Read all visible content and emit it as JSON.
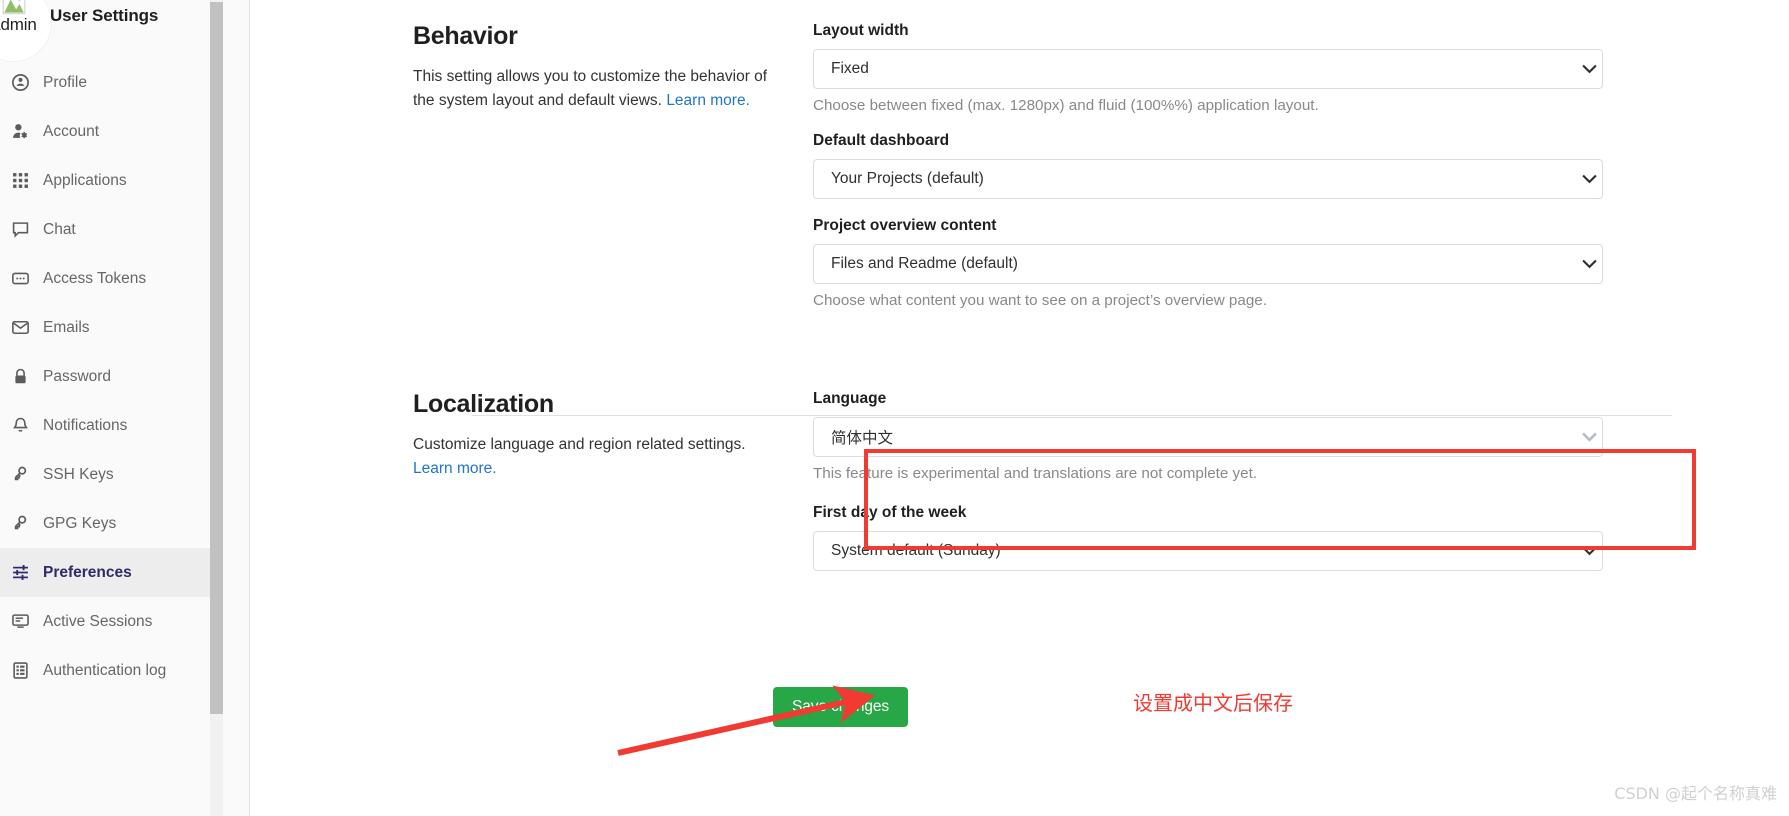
{
  "sidebar": {
    "avatar_name": "Admin",
    "title": "User Settings",
    "items": [
      {
        "label": "Profile",
        "icon": "user-circle-icon",
        "active": false
      },
      {
        "label": "Account",
        "icon": "user-gear-icon",
        "active": false
      },
      {
        "label": "Applications",
        "icon": "grid-apps-icon",
        "active": false
      },
      {
        "label": "Chat",
        "icon": "chat-bubble-icon",
        "active": false
      },
      {
        "label": "Access Tokens",
        "icon": "token-card-icon",
        "active": false
      },
      {
        "label": "Emails",
        "icon": "envelope-icon",
        "active": false
      },
      {
        "label": "Password",
        "icon": "lock-icon",
        "active": false
      },
      {
        "label": "Notifications",
        "icon": "bell-icon",
        "active": false
      },
      {
        "label": "SSH Keys",
        "icon": "key-icon",
        "active": false
      },
      {
        "label": "GPG Keys",
        "icon": "key-icon",
        "active": false
      },
      {
        "label": "Preferences",
        "icon": "sliders-icon",
        "active": true
      },
      {
        "label": "Active Sessions",
        "icon": "monitor-icon",
        "active": false
      },
      {
        "label": "Authentication log",
        "icon": "log-book-icon",
        "active": false
      }
    ]
  },
  "behavior": {
    "heading": "Behavior",
    "description": "This setting allows you to customize the behavior of the system layout and default views.",
    "learn_more": "Learn more.",
    "fields": {
      "layout_width": {
        "label": "Layout width",
        "value": "Fixed",
        "help": "Choose between fixed (max. 1280px) and fluid (100%%) application layout."
      },
      "default_dashboard": {
        "label": "Default dashboard",
        "value": "Your Projects (default)",
        "help": ""
      },
      "project_overview_content": {
        "label": "Project overview content",
        "value": "Files and Readme (default)",
        "help": "Choose what content you want to see on a project’s overview page."
      }
    }
  },
  "localization": {
    "heading": "Localization",
    "description": "Customize language and region related settings.",
    "learn_more": "Learn more.",
    "fields": {
      "language": {
        "label": "Language",
        "value": "简体中文",
        "help": "This feature is experimental and translations are not complete yet."
      },
      "first_day_of_week": {
        "label": "First day of the week",
        "value": "System default (Sunday)",
        "help": ""
      }
    }
  },
  "actions": {
    "save_label": "Save changes"
  },
  "annotations": {
    "highlight_color": "#f03a32",
    "arrow_color": "#f03a32",
    "note_text": "设置成中文后保存",
    "watermark": "CSDN @起个名称真难"
  },
  "colors": {
    "save_button": "#27a745",
    "link": "#1f75cb",
    "active_nav": "#2f2a6b",
    "active_nav_bg": "#ededed",
    "sidebar_bg": "#fafafa"
  }
}
